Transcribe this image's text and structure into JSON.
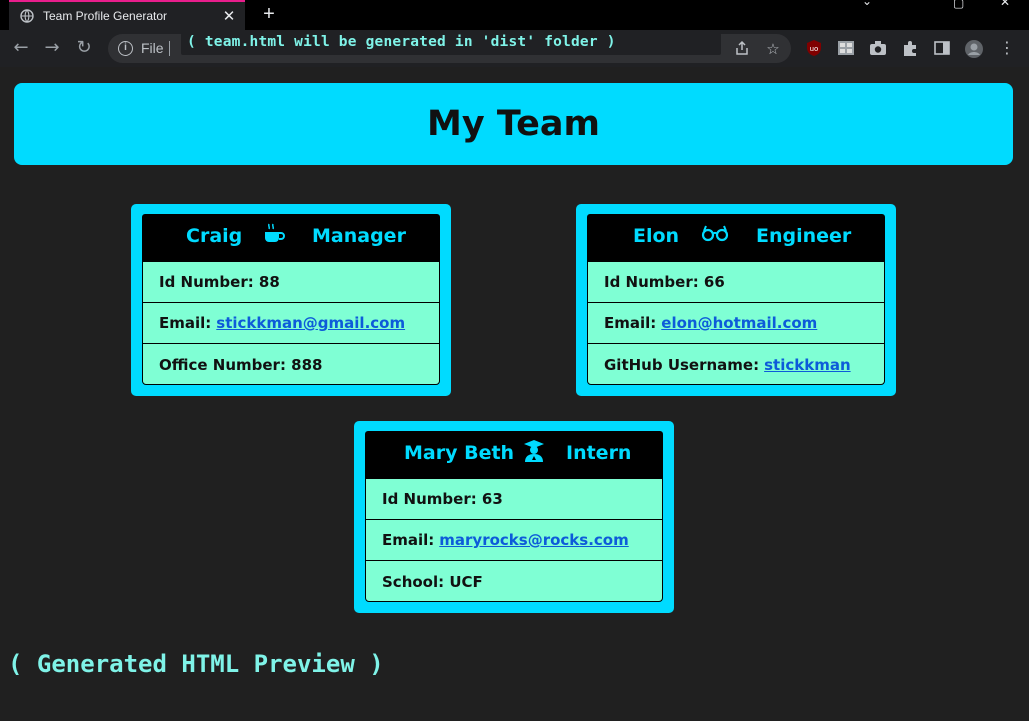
{
  "browser": {
    "tab_title": "Team Profile Generator",
    "address_scheme": "File",
    "address_note": "( team.html will be generated in 'dist' folder )"
  },
  "page": {
    "title": "My Team",
    "caption": "( Generated HTML Preview )"
  },
  "colors": {
    "accent": "#00dbff",
    "row_bg": "#7fffd4",
    "link": "#0d5bd9",
    "tab_indicator": "#e91e8c"
  },
  "team": [
    {
      "name": "Craig",
      "role": "Manager",
      "icon": "coffee-icon",
      "rows": [
        {
          "label": "Id Number: 88",
          "link": ""
        },
        {
          "label": "Email:",
          "link": "stickkman@gmail.com"
        },
        {
          "label": "Office Number: 888",
          "link": ""
        }
      ]
    },
    {
      "name": "Elon",
      "role": "Engineer",
      "icon": "glasses-icon",
      "rows": [
        {
          "label": "Id Number: 66",
          "link": ""
        },
        {
          "label": "Email:",
          "link": "elon@hotmail.com"
        },
        {
          "label": "GitHub Username:",
          "link": "stickkman"
        }
      ]
    },
    {
      "name": "Mary Beth",
      "role": "Intern",
      "icon": "graduate-icon",
      "rows": [
        {
          "label": "Id Number: 63",
          "link": ""
        },
        {
          "label": "Email:",
          "link": "maryrocks@rocks.com"
        },
        {
          "label": "School: UCF",
          "link": ""
        }
      ]
    }
  ]
}
